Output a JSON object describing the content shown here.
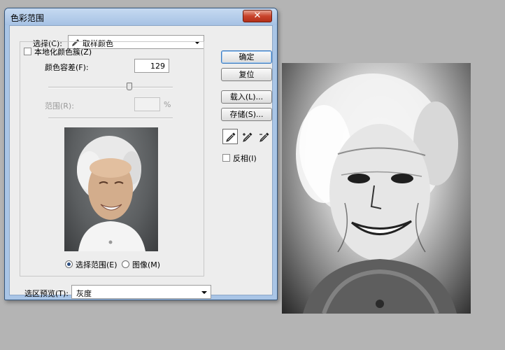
{
  "dialog": {
    "title": "色彩范围",
    "close_glyph": "✕",
    "select": {
      "label": "选择(C):",
      "value": "取样颜色"
    },
    "localized_clusters": {
      "label": "本地化颜色簇(Z)",
      "checked": false
    },
    "fuzziness": {
      "label": "颜色容差(F):",
      "value": "129",
      "slider_fraction": 0.65
    },
    "range": {
      "label": "范围(R):",
      "value": "",
      "unit": "%",
      "slider_fraction": 0.5
    },
    "view_options": {
      "selection_label": "选择范围(E)",
      "image_label": "图像(M)",
      "selected": "selection"
    },
    "selection_preview": {
      "label": "选区预览(T):",
      "value": "灰度"
    },
    "buttons": {
      "ok": "确定",
      "reset": "复位",
      "load": "载入(L)...",
      "save": "存储(S)..."
    },
    "tools": [
      "eyedropper-icon",
      "eyedropper-plus-icon",
      "eyedropper-minus-icon"
    ],
    "invert": {
      "label": "反相(I)",
      "checked": false
    }
  },
  "colors": {
    "window_frame": "#a9c5e6",
    "client_bg": "#ededed",
    "close_button": "#c8432b",
    "background": "#b4b4b4",
    "default_button_border": "#3d7bbf"
  }
}
